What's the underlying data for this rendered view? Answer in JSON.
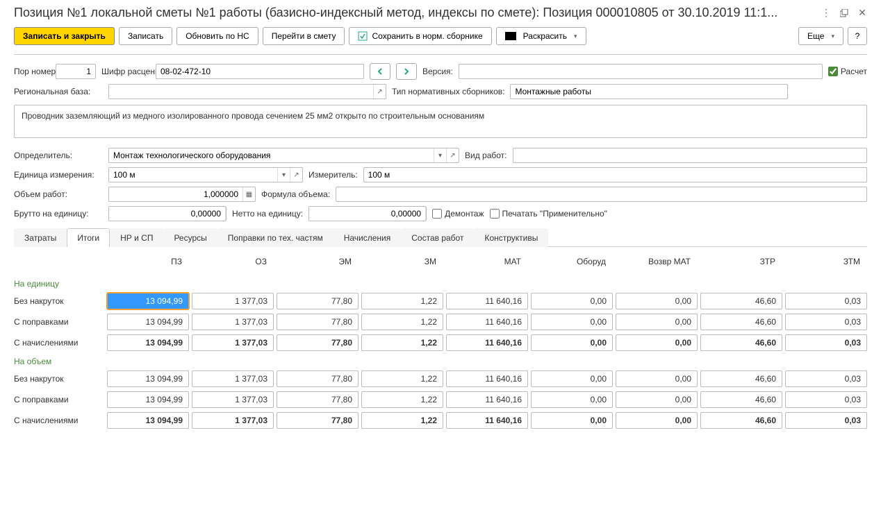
{
  "title": "Позиция №1 локальной сметы №1 работы (базисно-индексный метод, индексы по смете): Позиция 000010805 от 30.10.2019 11:1...",
  "toolbar": {
    "save_close": "Записать и закрыть",
    "save": "Записать",
    "update_ns": "Обновить по НС",
    "goto_estimate": "Перейти в смету",
    "save_norm": "Сохранить в норм. сборнике",
    "colorize": "Раскрасить",
    "more": "Еще",
    "help": "?"
  },
  "form": {
    "por_label": "Пор номер:",
    "por_value": "1",
    "code_label": "Шифр расценки:",
    "code_value": "08-02-472-10",
    "version_label": "Версия:",
    "version_value": "",
    "calc_label": "Расчет",
    "regbase_label": "Региональная база:",
    "regbase_value": "",
    "normtype_label": "Тип нормативных сборников:",
    "normtype_value": "Монтажные работы",
    "description": "Проводник заземляющий из медного изолированного провода сечением 25 мм2 открыто по строительным основаниям",
    "determiner_label": "Определитель:",
    "determiner_value": "Монтаж технологического оборудования",
    "worktype_label": "Вид работ:",
    "worktype_value": "",
    "unit_label": "Единица измерения:",
    "unit_value": "100 м",
    "measurer_label": "Измеритель:",
    "measurer_value": "100 м",
    "volume_label": "Объем работ:",
    "volume_value": "1,000000",
    "formula_label": "Формула объема:",
    "formula_value": "",
    "brutto_label": "Брутто на единицу:",
    "brutto_value": "0,00000",
    "netto_label": "Нетто на единицу:",
    "netto_value": "0,00000",
    "dismantle_label": "Демонтаж",
    "print_appl_label": "Печатать \"Применительно\""
  },
  "tabs": [
    "Затраты",
    "Итоги",
    "НР и СП",
    "Ресурсы",
    "Поправки по тех. частям",
    "Начисления",
    "Состав работ",
    "Конструктивы"
  ],
  "active_tab": 1,
  "results": {
    "columns": [
      "ПЗ",
      "ОЗ",
      "ЭМ",
      "ЗМ",
      "МАТ",
      "Оборуд",
      "Возвр МАТ",
      "ЗТР",
      "ЗТМ"
    ],
    "sections": [
      {
        "title": "На единицу",
        "rows": [
          {
            "label": "Без накруток",
            "cells": [
              "13 094,99",
              "1 377,03",
              "77,80",
              "1,22",
              "11 640,16",
              "0,00",
              "0,00",
              "46,60",
              "0,03"
            ],
            "sel": 0
          },
          {
            "label": "С поправками",
            "cells": [
              "13 094,99",
              "1 377,03",
              "77,80",
              "1,22",
              "11 640,16",
              "0,00",
              "0,00",
              "46,60",
              "0,03"
            ]
          },
          {
            "label": "С начислениями",
            "cells": [
              "13 094,99",
              "1 377,03",
              "77,80",
              "1,22",
              "11 640,16",
              "0,00",
              "0,00",
              "46,60",
              "0,03"
            ],
            "bold": true
          }
        ]
      },
      {
        "title": "На объем",
        "rows": [
          {
            "label": "Без накруток",
            "cells": [
              "13 094,99",
              "1 377,03",
              "77,80",
              "1,22",
              "11 640,16",
              "0,00",
              "0,00",
              "46,60",
              "0,03"
            ]
          },
          {
            "label": "С поправками",
            "cells": [
              "13 094,99",
              "1 377,03",
              "77,80",
              "1,22",
              "11 640,16",
              "0,00",
              "0,00",
              "46,60",
              "0,03"
            ]
          },
          {
            "label": "С начислениями",
            "cells": [
              "13 094,99",
              "1 377,03",
              "77,80",
              "1,22",
              "11 640,16",
              "0,00",
              "0,00",
              "46,60",
              "0,03"
            ],
            "bold": true
          }
        ]
      }
    ]
  }
}
